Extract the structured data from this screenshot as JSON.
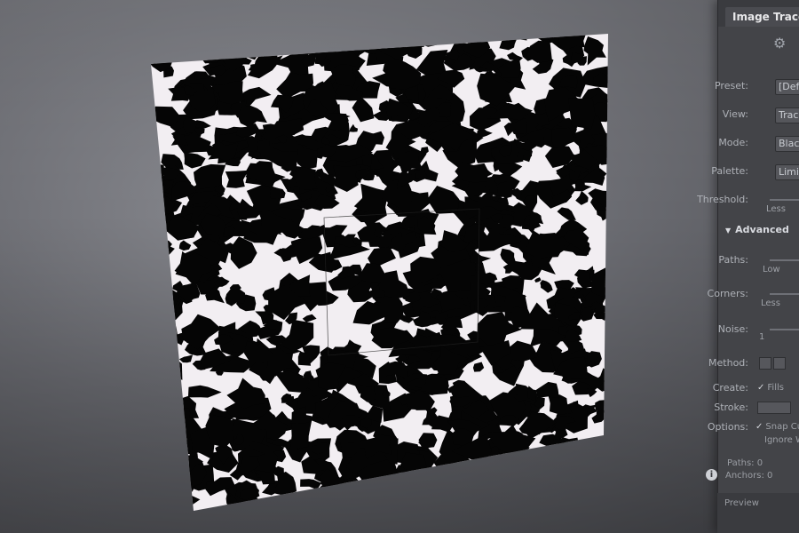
{
  "panel": {
    "tab_label": "Image Trace",
    "icon": "trace-preset-icon",
    "preset": {
      "label": "Preset:",
      "value": "[Def"
    },
    "view": {
      "label": "View:",
      "value": "Trac"
    },
    "mode": {
      "label": "Mode:",
      "value": "Black"
    },
    "palette": {
      "label": "Palette:",
      "value": "Limit"
    },
    "threshold": {
      "label": "Threshold:",
      "sub": "Less"
    },
    "advanced": {
      "label": "Advanced"
    },
    "paths": {
      "label": "Paths:",
      "sub": "Low"
    },
    "corners": {
      "label": "Corners:",
      "sub": "Less"
    },
    "noise": {
      "label": "Noise:",
      "sub": "1"
    },
    "method": {
      "label": "Method:"
    },
    "create": {
      "label": "Create:",
      "fills": "Fills"
    },
    "stroke": {
      "label": "Stroke:"
    },
    "options": {
      "label": "Options:",
      "snap": "Snap Cu",
      "ignore": "Ignore W"
    },
    "stats": {
      "paths_label": "Paths:",
      "paths_value": "0",
      "anchors_label": "Anchors:",
      "anchors_value": "0"
    },
    "preview_label": "Preview"
  },
  "colors": {
    "panel_bg": "#434448",
    "artboard_bg": "#f2eef2",
    "trace_fill": "#050505"
  }
}
